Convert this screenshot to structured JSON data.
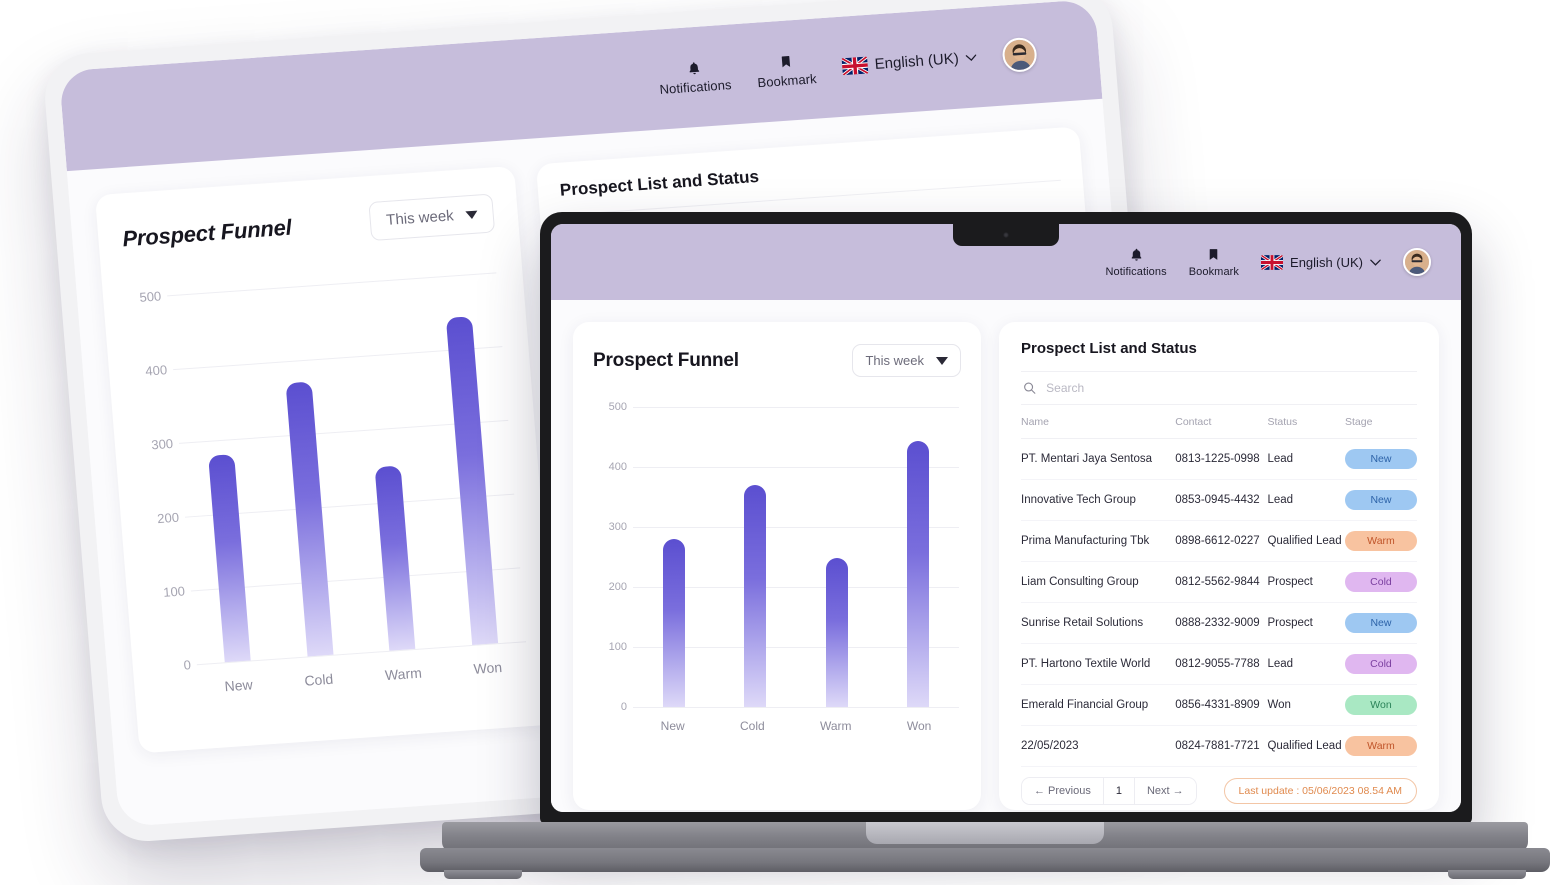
{
  "topbar": {
    "notifications_label": "Notifications",
    "bookmark_label": "Bookmark",
    "language_label": "English (UK)",
    "notifications_icon": "bell-icon",
    "bookmark_icon": "bookmark-icon",
    "flag_icon": "uk-flag-icon",
    "chevron_icon": "chevron-down-icon",
    "avatar_icon": "user-avatar"
  },
  "chart_panel": {
    "title": "Prospect Funnel",
    "period_label": "This week",
    "period_options": [
      "This week"
    ]
  },
  "chart_data": {
    "type": "bar",
    "title": "Prospect Funnel",
    "categories": [
      "New",
      "Cold",
      "Warm",
      "Won"
    ],
    "values": [
      280,
      370,
      248,
      443
    ],
    "xlabel": "",
    "ylabel": "",
    "ylim": [
      0,
      500
    ],
    "yticks": [
      0,
      100,
      200,
      300,
      400,
      500
    ],
    "grid": true,
    "legend": "none",
    "bar_color_top": "#5b4fd0",
    "bar_color_bottom": "#ded9f8"
  },
  "table_panel": {
    "title": "Prospect List and Status",
    "search_placeholder": "Search",
    "search_value": "",
    "search_icon": "search-icon",
    "columns": [
      "Name",
      "Contact",
      "Status",
      "Stage"
    ],
    "rows": [
      {
        "name": "PT. Mentari Jaya Sentosa",
        "contact": "0813-1225-0998",
        "status": "Lead",
        "stage": "New",
        "stage_type": "new"
      },
      {
        "name": "Innovative Tech Group",
        "contact": "0853-0945-4432",
        "status": "Lead",
        "stage": "New",
        "stage_type": "new"
      },
      {
        "name": "Prima Manufacturing Tbk",
        "contact": "0898-6612-0227",
        "status": "Qualified Lead",
        "stage": "Warm",
        "stage_type": "warm"
      },
      {
        "name": "Liam Consulting Group",
        "contact": "0812-5562-9844",
        "status": "Prospect",
        "stage": "Cold",
        "stage_type": "cold"
      },
      {
        "name": "Sunrise Retail Solutions",
        "contact": "0888-2332-9009",
        "status": "Prospect",
        "stage": "New",
        "stage_type": "new"
      },
      {
        "name": "PT. Hartono Textile World",
        "contact": "0812-9055-7788",
        "status": "Lead",
        "stage": "Cold",
        "stage_type": "cold"
      },
      {
        "name": "Emerald Financial Group",
        "contact": "0856-4331-8909",
        "status": "Won",
        "stage": "Won",
        "stage_type": "won"
      },
      {
        "name": "22/05/2023",
        "contact": "0824-7881-7721",
        "status": "Qualified Lead",
        "stage": "Warm",
        "stage_type": "warm"
      }
    ],
    "pagination": {
      "previous_label": "←  Previous",
      "page_label": "1",
      "next_label": "Next  →"
    },
    "last_update": "Last update : 05/06/2023 08.54 AM"
  },
  "colors": {
    "header_purple": "#c6bddb",
    "accent_purple": "#5b4fd0",
    "badge_new": "#9ec8f2",
    "badge_warm": "#f8c3a0",
    "badge_cold": "#e0b7f0",
    "badge_won": "#a9e8c3",
    "last_update_border": "#f3c6a6"
  }
}
